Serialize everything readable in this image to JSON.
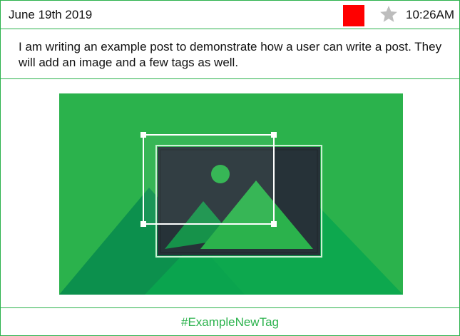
{
  "header": {
    "date": "June 19th 2019",
    "time": "10:26AM",
    "color_swatch": "#ff0000",
    "star_icon": "star-icon",
    "star_color": "#bdbdbd"
  },
  "post": {
    "text": "I am writing an example post to demonstrate how a user can write a post. They will add an image and a few tags as well."
  },
  "image": {
    "icon": "image-placeholder-icon",
    "background_color": "#2bb24c"
  },
  "tags": [
    "#ExampleNewTag"
  ],
  "colors": {
    "accent": "#2bb24c",
    "text": "#111111"
  }
}
